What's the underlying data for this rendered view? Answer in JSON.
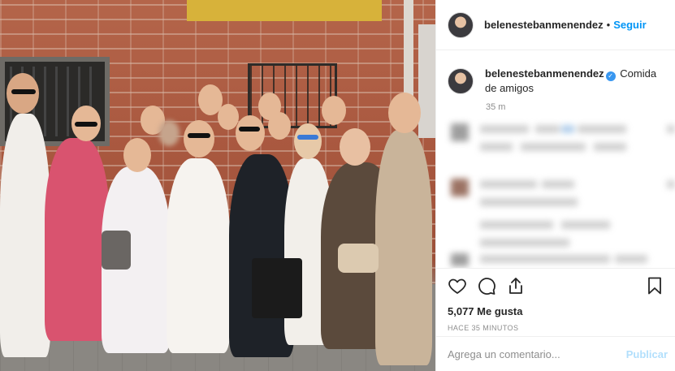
{
  "post": {
    "header": {
      "username": "belenestebanmenendez",
      "separator": "•",
      "follow_label": "Seguir"
    },
    "caption": {
      "username": "belenestebanmenendez",
      "text": "Comida de amigos",
      "time": "35 m"
    },
    "likes_text": "5,077 Me gusta",
    "timestamp": "HACE 35 MINUTOS",
    "comment_input": {
      "placeholder": "Agrega un comentario...",
      "value": ""
    },
    "publish_label": "Publicar"
  },
  "icons": {
    "like": "heart-icon",
    "comment": "comment-icon",
    "share": "share-icon",
    "save": "bookmark-icon",
    "verified": "verified-badge-icon"
  },
  "colors": {
    "link_blue": "#0095f6",
    "publish_disabled": "#b2dffc",
    "verified": "#3897f0",
    "muted_text": "#8e8e8e",
    "border": "#efefef"
  }
}
